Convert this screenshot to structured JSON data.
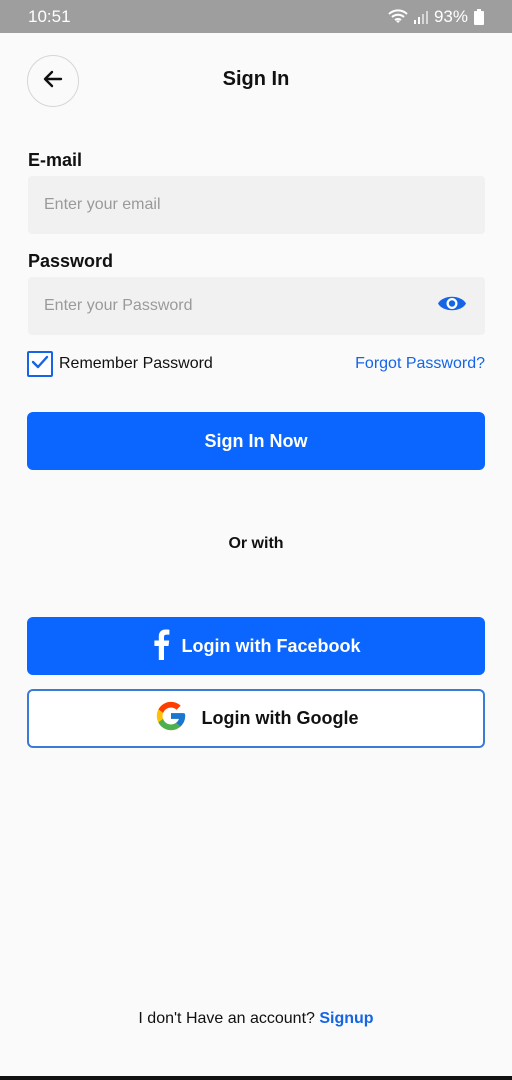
{
  "status_bar": {
    "time": "10:51",
    "battery": "93%",
    "icons": [
      "wifi-icon",
      "signal-icon",
      "battery-icon"
    ]
  },
  "header": {
    "back_icon": "arrow-left-icon",
    "title": "Sign In"
  },
  "form": {
    "email": {
      "label": "E-mail",
      "placeholder": "Enter your email",
      "value": ""
    },
    "password": {
      "label": "Password",
      "placeholder": "Enter your Password",
      "value": "",
      "toggle_icon": "eye-icon"
    },
    "remember": {
      "label": "Remember Password",
      "checked": true
    },
    "forgot_link": "Forgot Password?",
    "submit_label": "Sign In Now"
  },
  "divider_text": "Or with",
  "social": {
    "facebook_label": "Login with Facebook",
    "google_label": "Login with Google"
  },
  "footer": {
    "prompt": "I don't Have an account? ",
    "signup_link": "Signup"
  },
  "colors": {
    "primary": "#0a66ff",
    "link": "#1565e6",
    "background": "#fafafa",
    "input_bg": "#f1f1f1",
    "status_bar": "#9e9e9e"
  }
}
